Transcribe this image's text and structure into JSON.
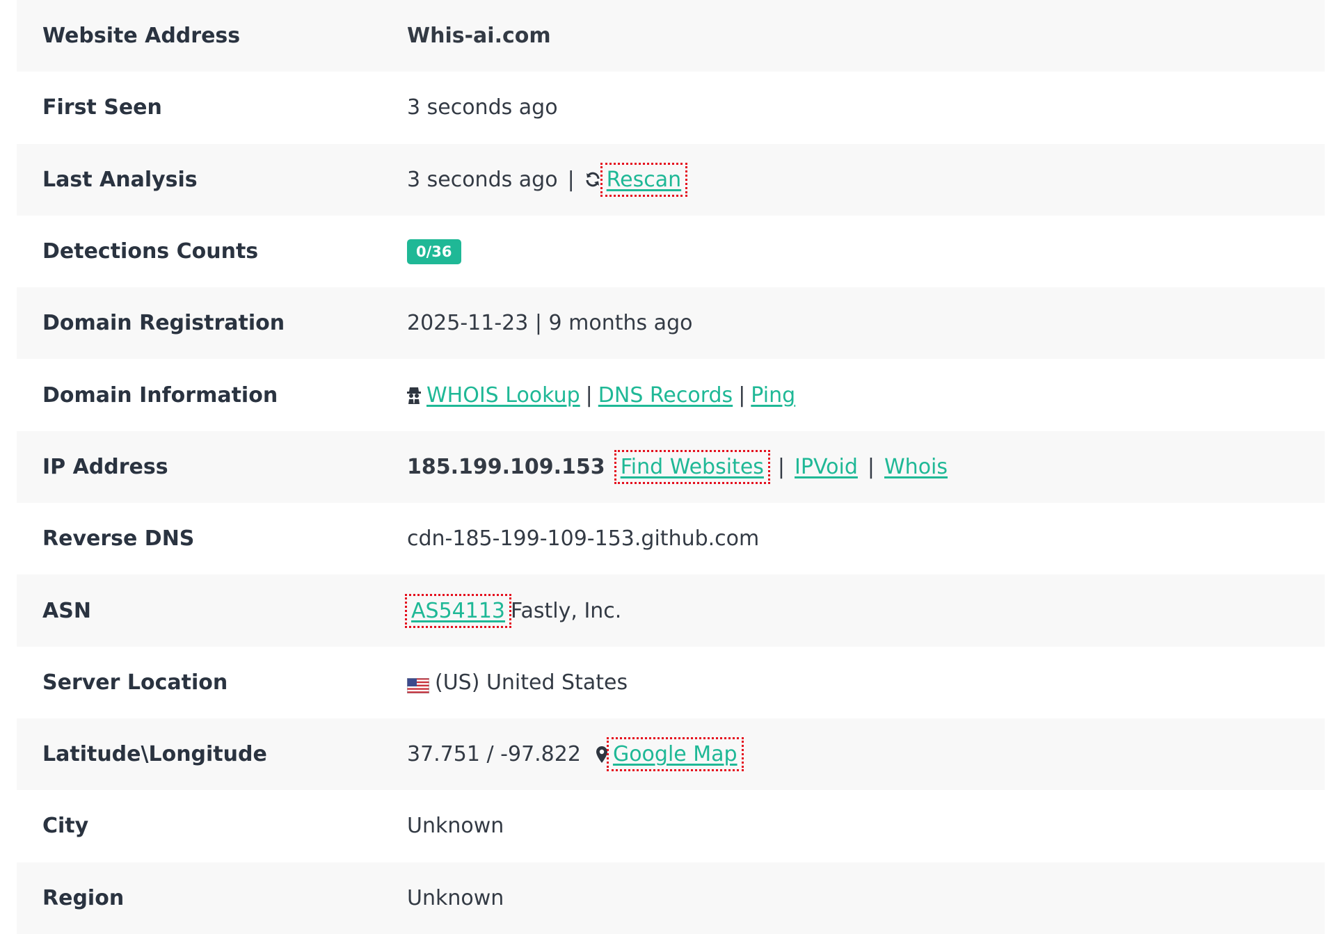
{
  "rows": [
    {
      "label": "Website Address",
      "value": "Whis-ai.com"
    },
    {
      "label": "First Seen",
      "value": "3 seconds ago"
    },
    {
      "label": "Last Analysis",
      "value": "3 seconds ago",
      "sep": "|",
      "action": "Rescan",
      "icon": "refresh-icon"
    },
    {
      "label": "Detections Counts",
      "badge": "0/36"
    },
    {
      "label": "Domain Registration",
      "value": "2025-11-23 | 9 months ago"
    },
    {
      "label": "Domain Information",
      "icon": "spy-icon",
      "links": [
        "WHOIS Lookup",
        "DNS Records",
        "Ping"
      ],
      "sep": "|"
    },
    {
      "label": "IP Address",
      "value": "185.199.109.153",
      "links": [
        "Find Websites",
        "IPVoid",
        "Whois"
      ],
      "sep": "|"
    },
    {
      "label": "Reverse DNS",
      "value": "cdn-185-199-109-153.github.com"
    },
    {
      "label": "ASN",
      "link": "AS54113",
      "value": "Fastly, Inc."
    },
    {
      "label": "Server Location",
      "icon": "us-flag-icon",
      "value": "(US) United States"
    },
    {
      "label": "Latitude\\Longitude",
      "value": "37.751 / -97.822",
      "icon": "map-pin-icon",
      "link": "Google Map"
    },
    {
      "label": "City",
      "value": "Unknown"
    },
    {
      "label": "Region",
      "value": "Unknown"
    }
  ],
  "colors": {
    "accent": "#1fb896",
    "highlight": "#e4101e",
    "row_shade": "#f8f8f8"
  }
}
